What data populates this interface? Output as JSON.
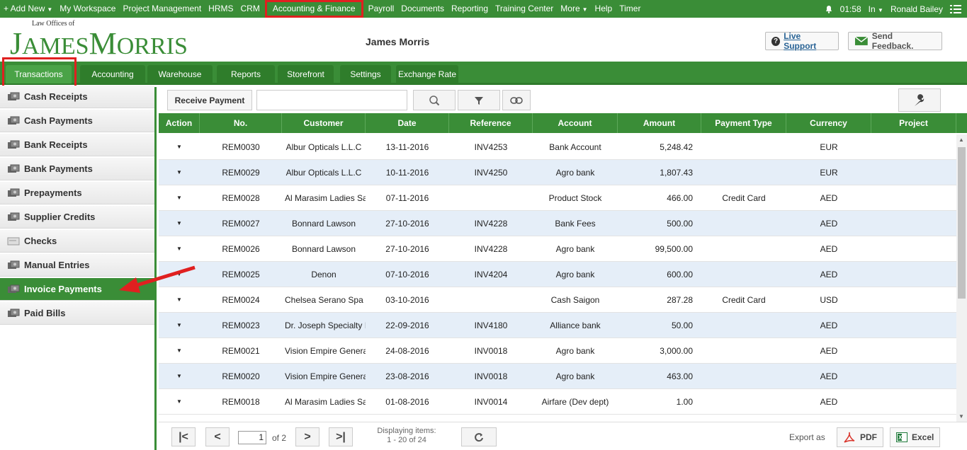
{
  "topnav": {
    "items": [
      {
        "label": "+ Add New",
        "caret": true
      },
      {
        "label": "My Workspace"
      },
      {
        "label": "Project Management"
      },
      {
        "label": "HRMS"
      },
      {
        "label": "CRM"
      },
      {
        "label": "Accounting & Finance",
        "highlight": true
      },
      {
        "label": "Payroll"
      },
      {
        "label": "Documents"
      },
      {
        "label": "Reporting"
      },
      {
        "label": "Training Center"
      },
      {
        "label": "More",
        "caret": true
      },
      {
        "label": "Help"
      },
      {
        "label": "Timer"
      }
    ],
    "time": "01:58",
    "status": "In",
    "user": "Ronald Bailey"
  },
  "header": {
    "logo_small": "Law Offices of",
    "logo_big": "JAMES MORRIS",
    "company": "James Morris",
    "live_support": "Live Support",
    "feedback": "Send Feedback."
  },
  "tabs": [
    "Transactions",
    "Accounting",
    "Warehouse",
    "Reports",
    "Storefront",
    "Settings",
    "Exchange Rate"
  ],
  "sidebar": {
    "items": [
      "Cash Receipts",
      "Cash Payments",
      "Bank Receipts",
      "Bank Payments",
      "Prepayments",
      "Supplier Credits",
      "Checks",
      "Manual Entries",
      "Invoice Payments",
      "Paid Bills"
    ],
    "active": "Invoice Payments"
  },
  "toolbar": {
    "receive_label": "Receive Payment",
    "search_placeholder": ""
  },
  "table": {
    "columns": [
      "Action",
      "No.",
      "Customer",
      "Date",
      "Reference",
      "Account",
      "Amount",
      "Payment Type",
      "Currency",
      "Project"
    ],
    "rows": [
      [
        "REM0030",
        "Albur Opticals L.L.C",
        "13-11-2016",
        "INV4253",
        "Bank Account",
        "5,248.42",
        "",
        "EUR",
        ""
      ],
      [
        "REM0029",
        "Albur Opticals L.L.C",
        "10-11-2016",
        "INV4250",
        "Agro bank",
        "1,807.43",
        "",
        "EUR",
        ""
      ],
      [
        "REM0028",
        "Al Marasim Ladies Sa",
        "07-11-2016",
        "",
        "Product Stock",
        "466.00",
        "Credit Card",
        "AED",
        ""
      ],
      [
        "REM0027",
        "Bonnard Lawson",
        "27-10-2016",
        "INV4228",
        "Bank Fees",
        "500.00",
        "",
        "AED",
        ""
      ],
      [
        "REM0026",
        "Bonnard Lawson",
        "27-10-2016",
        "INV4228",
        "Agro bank",
        "99,500.00",
        "",
        "AED",
        ""
      ],
      [
        "REM0025",
        "Denon",
        "07-10-2016",
        "INV4204",
        "Agro bank",
        "600.00",
        "",
        "AED",
        ""
      ],
      [
        "REM0024",
        "Chelsea Serano Spa",
        "03-10-2016",
        "",
        "Cash Saigon",
        "287.28",
        "Credit Card",
        "USD",
        ""
      ],
      [
        "REM0023",
        "Dr. Joseph Specialty I",
        "22-09-2016",
        "INV4180",
        "Alliance bank",
        "50.00",
        "",
        "AED",
        ""
      ],
      [
        "REM0021",
        "Vision Empire Genera",
        "24-08-2016",
        "INV0018",
        "Agro bank",
        "3,000.00",
        "",
        "AED",
        ""
      ],
      [
        "REM0020",
        "Vision Empire Genera",
        "23-08-2016",
        "INV0018",
        "Agro bank",
        "463.00",
        "",
        "AED",
        ""
      ],
      [
        "REM0018",
        "Al Marasim Ladies Sa",
        "01-08-2016",
        "INV0014",
        "Airfare (Dev dept)",
        "1.00",
        "",
        "AED",
        ""
      ]
    ]
  },
  "footer": {
    "page": "1",
    "of_text": "of 2",
    "displaying_line1": "Displaying items:",
    "displaying_line2": "1 - 20 of 24",
    "export_label": "Export as",
    "pdf_label": "PDF",
    "excel_label": "Excel"
  },
  "colors": {
    "brand_green": "#3a8d37",
    "highlight_red": "#e02020",
    "row_alt": "#e5eef8"
  }
}
